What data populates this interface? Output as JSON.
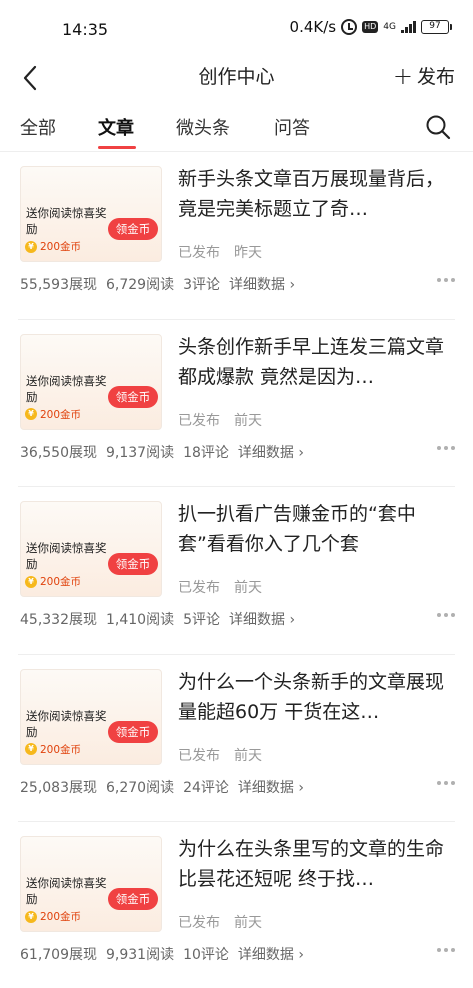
{
  "status_bar": {
    "time": "14:35",
    "net_speed": "0.4K/s",
    "hd": "HD",
    "network": "4G",
    "battery": "97"
  },
  "nav": {
    "title": "创作中心",
    "publish_label": "发布",
    "publish_icon": "+"
  },
  "tabs": [
    {
      "label": "全部"
    },
    {
      "label": "文章"
    },
    {
      "label": "微头条"
    },
    {
      "label": "问答"
    }
  ],
  "active_tab": "文章",
  "accent_color": "#f04142",
  "articles": [
    {
      "thumb_text": "送你阅读惊喜奖励",
      "coin_text": "200金币",
      "claim_label": "领金币",
      "title": "新手头条文章百万展现量背后，竟是完美标题立了奇…",
      "status": "已发布",
      "time": "昨天",
      "impressions": "55,593展现",
      "reads": "6,729阅读",
      "comments": "3评论",
      "detail": "详细数据 ›"
    },
    {
      "thumb_text": "送你阅读惊喜奖励",
      "coin_text": "200金币",
      "claim_label": "领金币",
      "title": "头条创作新手早上连发三篇文章都成爆款 竟然是因为…",
      "status": "已发布",
      "time": "前天",
      "impressions": "36,550展现",
      "reads": "9,137阅读",
      "comments": "18评论",
      "detail": "详细数据 ›"
    },
    {
      "thumb_text": "送你阅读惊喜奖励",
      "coin_text": "200金币",
      "claim_label": "领金币",
      "title": "扒一扒看广告赚金币的“套中套”看看你入了几个套",
      "status": "已发布",
      "time": "前天",
      "impressions": "45,332展现",
      "reads": "1,410阅读",
      "comments": "5评论",
      "detail": "详细数据 ›"
    },
    {
      "thumb_text": "送你阅读惊喜奖励",
      "coin_text": "200金币",
      "claim_label": "领金币",
      "title": "为什么一个头条新手的文章展现量能超60万 干货在这…",
      "status": "已发布",
      "time": "前天",
      "impressions": "25,083展现",
      "reads": "6,270阅读",
      "comments": "24评论",
      "detail": "详细数据 ›"
    },
    {
      "thumb_text": "送你阅读惊喜奖励",
      "coin_text": "200金币",
      "claim_label": "领金币",
      "title": "为什么在头条里写的文章的生命比昙花还短呢 终于找…",
      "status": "已发布",
      "time": "前天",
      "impressions": "61,709展现",
      "reads": "9,931阅读",
      "comments": "10评论",
      "detail": "详细数据 ›"
    }
  ]
}
